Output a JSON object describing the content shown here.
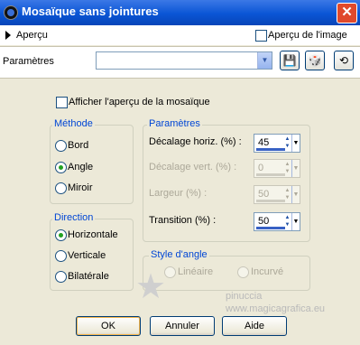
{
  "window": {
    "title": "Mosaïque sans jointures",
    "close_symbol": "✕"
  },
  "preview": {
    "toggle_label": "Aperçu",
    "image_label": "Aperçu de l'image",
    "image_checked": false
  },
  "presets": {
    "label": "Paramètres",
    "value": "",
    "arrow": "▼"
  },
  "options": {
    "show_tiling_preview": "Afficher l'aperçu de la mosaïque",
    "show_tiling_preview_checked": false
  },
  "method": {
    "legend": "Méthode",
    "options": [
      "Bord",
      "Angle",
      "Miroir"
    ],
    "selected": "Angle"
  },
  "direction": {
    "legend": "Direction",
    "options": [
      "Horizontale",
      "Verticale",
      "Bilatérale"
    ],
    "selected": "Horizontale"
  },
  "parameters": {
    "legend": "Paramètres",
    "h_offset_label": "Décalage horiz. (%) :",
    "h_offset_value": "45",
    "v_offset_label": "Décalage vert. (%) :",
    "v_offset_value": "0",
    "width_label": "Largeur (%) :",
    "width_value": "50",
    "transition_label": "Transition (%) :",
    "transition_value": "50"
  },
  "corner_style": {
    "legend": "Style d'angle",
    "options": [
      "Linéaire",
      "Incurvé"
    ]
  },
  "buttons": {
    "ok": "OK",
    "cancel": "Annuler",
    "help": "Aide"
  },
  "watermark": {
    "line1": "pinuccia",
    "line2": "www.magicagrafica.eu"
  },
  "colors": {
    "titlebar": "#0a55d5",
    "legend": "#0046d5",
    "radio_dot": "#21a121"
  }
}
